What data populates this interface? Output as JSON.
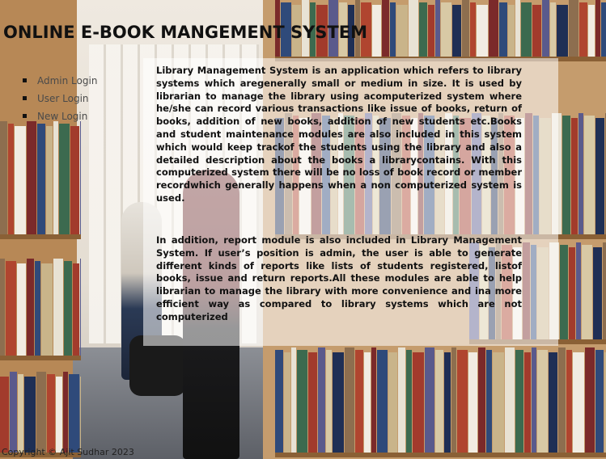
{
  "header": {
    "title": "ONLINE E-BOOK MANGEMENT SYSTEM"
  },
  "nav": {
    "items": [
      {
        "label": "Admin Login"
      },
      {
        "label": "User Login"
      },
      {
        "label": "New Login"
      }
    ]
  },
  "main": {
    "paragraphs": [
      "Library Management System is an application which refers to library systems which aregenerally small or medium in size. It is used by librarian to manage the library using acomputerized system where he/she can record various transactions like issue of books, return of books, addition of new books, addition of new students etc.Books and student maintenance modules are also included in this system which would keep trackof the students using the library and also a detailed description about the books a librarycontains. With this computerized system there will be no loss of book record or member recordwhich generally happens when a non computerized system is used.",
      "In addition, report module is also included in Library Management System. If user’s position is admin, the user is able to generate different kinds of reports like lists of students registered, listof books, issue and return reports.All these modules are able to help librarian to manage the library with more convenience and ina more efficient way as compared to library systems which are not computerized"
    ]
  },
  "footer": {
    "text": "Copyright © Ajit Sudhar 2023"
  }
}
